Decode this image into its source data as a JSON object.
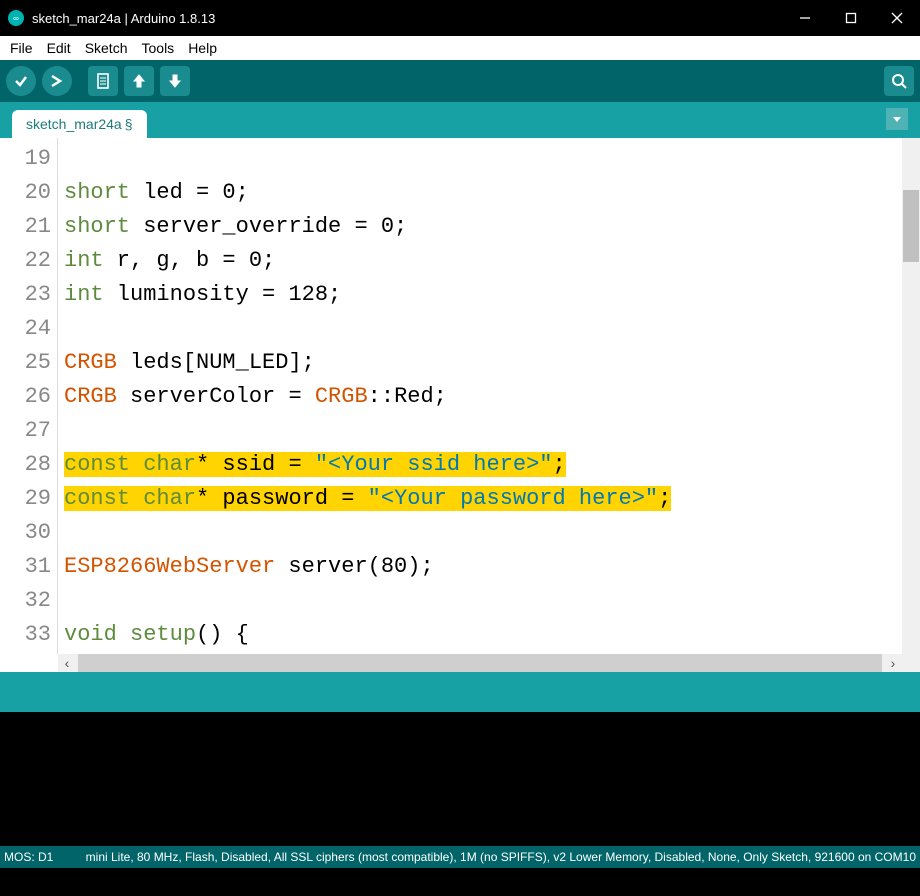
{
  "window": {
    "title": "sketch_mar24a | Arduino 1.8.13"
  },
  "menu": {
    "file": "File",
    "edit": "Edit",
    "sketch": "Sketch",
    "tools": "Tools",
    "help": "Help"
  },
  "tab": {
    "name": "sketch_mar24a",
    "modified": "§"
  },
  "code": {
    "first_line_number": 19,
    "lines": [
      {
        "num": 19,
        "tokens": [
          {
            "t": "",
            "c": ""
          }
        ]
      },
      {
        "num": 20,
        "tokens": [
          {
            "t": "short",
            "c": "tok-kw"
          },
          {
            "t": " led = 0;",
            "c": ""
          }
        ]
      },
      {
        "num": 21,
        "tokens": [
          {
            "t": "short",
            "c": "tok-kw"
          },
          {
            "t": " server_override = 0;",
            "c": ""
          }
        ]
      },
      {
        "num": 22,
        "tokens": [
          {
            "t": "int",
            "c": "tok-kw"
          },
          {
            "t": " r, g, b = 0;",
            "c": ""
          }
        ]
      },
      {
        "num": 23,
        "tokens": [
          {
            "t": "int",
            "c": "tok-kw"
          },
          {
            "t": " luminosity = 128;",
            "c": ""
          }
        ]
      },
      {
        "num": 24,
        "tokens": [
          {
            "t": "",
            "c": ""
          }
        ]
      },
      {
        "num": 25,
        "tokens": [
          {
            "t": "CRGB",
            "c": "tok-type"
          },
          {
            "t": " leds[NUM_LED];",
            "c": ""
          }
        ]
      },
      {
        "num": 26,
        "tokens": [
          {
            "t": "CRGB",
            "c": "tok-type"
          },
          {
            "t": " serverColor = ",
            "c": ""
          },
          {
            "t": "CRGB",
            "c": "tok-type"
          },
          {
            "t": "::Red;",
            "c": ""
          }
        ]
      },
      {
        "num": 27,
        "tokens": [
          {
            "t": "",
            "c": ""
          }
        ]
      },
      {
        "num": 28,
        "hl": true,
        "tokens": [
          {
            "t": "const",
            "c": "tok-kw"
          },
          {
            "t": " ",
            "c": ""
          },
          {
            "t": "char",
            "c": "tok-kw"
          },
          {
            "t": "* ssid = ",
            "c": ""
          },
          {
            "t": "\"<Your ssid here>\"",
            "c": "tok-str"
          },
          {
            "t": ";",
            "c": ""
          }
        ]
      },
      {
        "num": 29,
        "hl": true,
        "tokens": [
          {
            "t": "const",
            "c": "tok-kw"
          },
          {
            "t": " ",
            "c": ""
          },
          {
            "t": "char",
            "c": "tok-kw"
          },
          {
            "t": "* password = ",
            "c": ""
          },
          {
            "t": "\"<Your password here>\"",
            "c": "tok-str"
          },
          {
            "t": ";",
            "c": ""
          }
        ]
      },
      {
        "num": 30,
        "tokens": [
          {
            "t": "",
            "c": ""
          }
        ]
      },
      {
        "num": 31,
        "tokens": [
          {
            "t": "ESP8266WebServer",
            "c": "tok-type"
          },
          {
            "t": " server(80);",
            "c": ""
          }
        ]
      },
      {
        "num": 32,
        "tokens": [
          {
            "t": "",
            "c": ""
          }
        ]
      },
      {
        "num": 33,
        "tokens": [
          {
            "t": "void",
            "c": "tok-kw"
          },
          {
            "t": " ",
            "c": ""
          },
          {
            "t": "setup",
            "c": "tok-kw"
          },
          {
            "t": "() {",
            "c": ""
          }
        ]
      }
    ]
  },
  "status": {
    "left": "MOS: D1",
    "right": "mini Lite, 80 MHz, Flash, Disabled, All SSL ciphers (most compatible), 1M (no SPIFFS), v2 Lower Memory, Disabled, None, Only Sketch, 921600 on COM10"
  }
}
